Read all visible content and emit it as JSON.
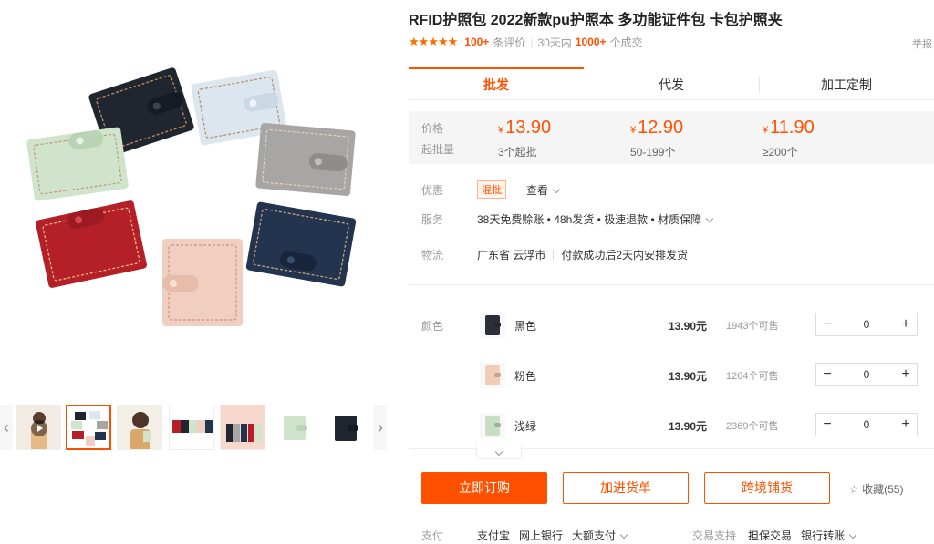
{
  "product": {
    "title": "RFID护照包 2022新款pu护照本 多功能证件包 卡包护照夹",
    "rating_stars": "★★★★★",
    "review_count": "100+",
    "review_label": "条评价",
    "sales_period": "30天内",
    "sales_count": "1000+",
    "sales_label": "个成交",
    "report_label": "举报"
  },
  "tabs": [
    {
      "label": "批发",
      "active": true
    },
    {
      "label": "代发",
      "active": false
    },
    {
      "label": "加工定制",
      "active": false
    }
  ],
  "pricing": {
    "price_label": "价格",
    "moq_label": "起批量",
    "currency": "¥",
    "tiers": [
      {
        "price": "13.90",
        "moq": "3个起批"
      },
      {
        "price": "12.90",
        "moq": "50-199个"
      },
      {
        "price": "11.90",
        "moq": "≥200个"
      }
    ]
  },
  "promo": {
    "label": "优惠",
    "tag": "混批",
    "view": "查看"
  },
  "service": {
    "label": "服务",
    "text": "38天免费赊账 • 48h发货 • 极速退款 • 材质保障"
  },
  "logistics": {
    "label": "物流",
    "location": "广东省 云浮市",
    "dispatch": "付款成功后2天内安排发货"
  },
  "sku": {
    "label": "颜色",
    "items": [
      {
        "name": "黑色",
        "price": "13.90元",
        "stock": "1943个可售",
        "qty": "0",
        "color": "#2a2f38"
      },
      {
        "name": "粉色",
        "price": "13.90元",
        "stock": "1264个可售",
        "qty": "0",
        "color": "#f1cdb8"
      },
      {
        "name": "浅绿",
        "price": "13.90元",
        "stock": "2369个可售",
        "qty": "0",
        "color": "#c9dcc4"
      }
    ],
    "minus": "−",
    "plus": "+"
  },
  "actions": {
    "buy_now": "立即订购",
    "add_to_list": "加进货单",
    "cross_border": "跨境铺货",
    "favorite": "收藏(55)"
  },
  "payment": {
    "label": "支付",
    "methods": [
      "支付宝",
      "网上银行",
      "大额支付"
    ],
    "trade_label": "交易支持",
    "trade_items": [
      "担保交易",
      "银行转账"
    ]
  },
  "gallery": {
    "wallet_colors": [
      "#1f2630",
      "#dbe6ef",
      "#a8a6a4",
      "#23344f",
      "#f1cfc0",
      "#b51f27",
      "#cfe4cb"
    ],
    "accent": "#ff5000"
  }
}
